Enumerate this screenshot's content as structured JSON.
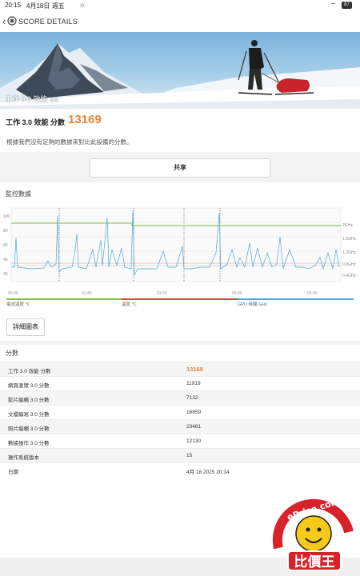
{
  "status_bar": {
    "time": "20:15",
    "date": "4月18日 週五",
    "battery": "87"
  },
  "app_bar": {
    "title": "SCORE DETAILS"
  },
  "hero": {
    "label": "工作 3.0 效能",
    "version": "3.0"
  },
  "score": {
    "label": "工作 3.0 效能 分數",
    "value": "13169"
  },
  "note": "根據我們沒有足夠的數據來對比此設備的分數。",
  "share_label": "共享",
  "monitoring": {
    "title": "監控數據",
    "legend": [
      {
        "label": "電池溫度 ℃",
        "color": "#7bc043"
      },
      {
        "label": "溫度 ℃",
        "color": "#e04040"
      },
      {
        "label": "GPU 時鐘 GHz",
        "color": "#4aa8d8"
      }
    ],
    "right_ticks": [
      "2GHz",
      "1.6GHz",
      "1.2GHz",
      "0.8GHz",
      "0.4GHz"
    ],
    "left_ticks": [
      "100",
      "80",
      "60",
      "40",
      "20"
    ],
    "x_ticks": [
      "00:00",
      "01:40",
      "03:20",
      "05:00",
      "06:40",
      "08:20"
    ]
  },
  "detail_button": "詳細圖表",
  "scores_section": {
    "title": "分數",
    "rows": [
      {
        "key": "工作 3.0 效能 分數",
        "value": "13169",
        "highlight": true
      },
      {
        "key": "網頁瀏覽 3.0 分數",
        "value": "11919"
      },
      {
        "key": "影片編輯 3.0 分數",
        "value": "7132"
      },
      {
        "key": "文檔編寫 3.0 分數",
        "value": "16859"
      },
      {
        "key": "照片編輯 3.0 分數",
        "value": "23481"
      },
      {
        "key": "數據操作 3.0 分數",
        "value": "12130"
      },
      {
        "key": "操作系統版本",
        "value": "15"
      },
      {
        "key": "日期",
        "value": "4月 18 2025 20:14"
      }
    ]
  },
  "watermark": {
    "site": "ePrice.com.tw",
    "brand": "比價王"
  }
}
